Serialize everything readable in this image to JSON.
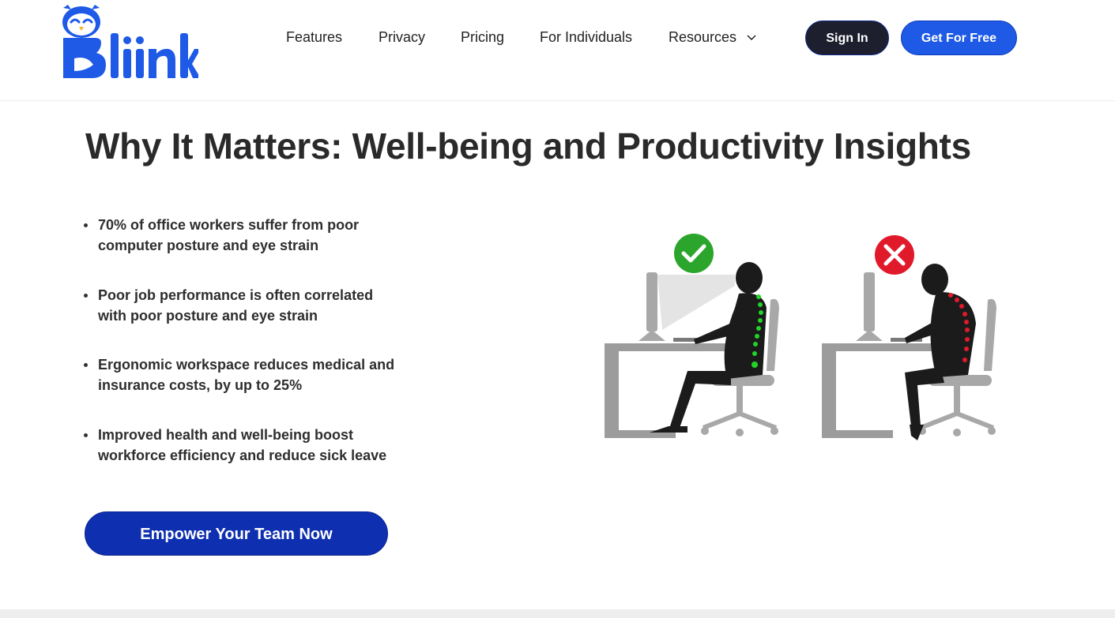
{
  "brand": {
    "name": "Bliink",
    "color": "#1e5ae6"
  },
  "nav": {
    "items": [
      {
        "label": "Features"
      },
      {
        "label": "Privacy"
      },
      {
        "label": "Pricing"
      },
      {
        "label": "For Individuals"
      },
      {
        "label": "Resources"
      }
    ],
    "resources_dropdown_icon": "chevron-down-icon"
  },
  "actions": {
    "sign_in": "Sign In",
    "get_free": "Get For Free"
  },
  "section": {
    "title": "Why It Matters: Well-being and Productivity Insights",
    "bullets": [
      {
        "line1": "70% of office workers suffer from poor",
        "line2": "computer posture and eye strain"
      },
      {
        "line1": "Poor job performance is often correlated",
        "line2": "with poor posture and eye strain"
      },
      {
        "line1": "Ergonomic workspace reduces medical and",
        "line2": "insurance costs, by up to 25%"
      },
      {
        "line1": "Improved health and well-being boost",
        "line2": "workforce efficiency and reduce sick leave"
      }
    ],
    "cta": "Empower Your Team Now"
  },
  "illustration": {
    "good_icon": "check-circle-icon",
    "bad_icon": "x-circle-icon",
    "good_color": "#2ba52b",
    "bad_color": "#e11a2b"
  }
}
